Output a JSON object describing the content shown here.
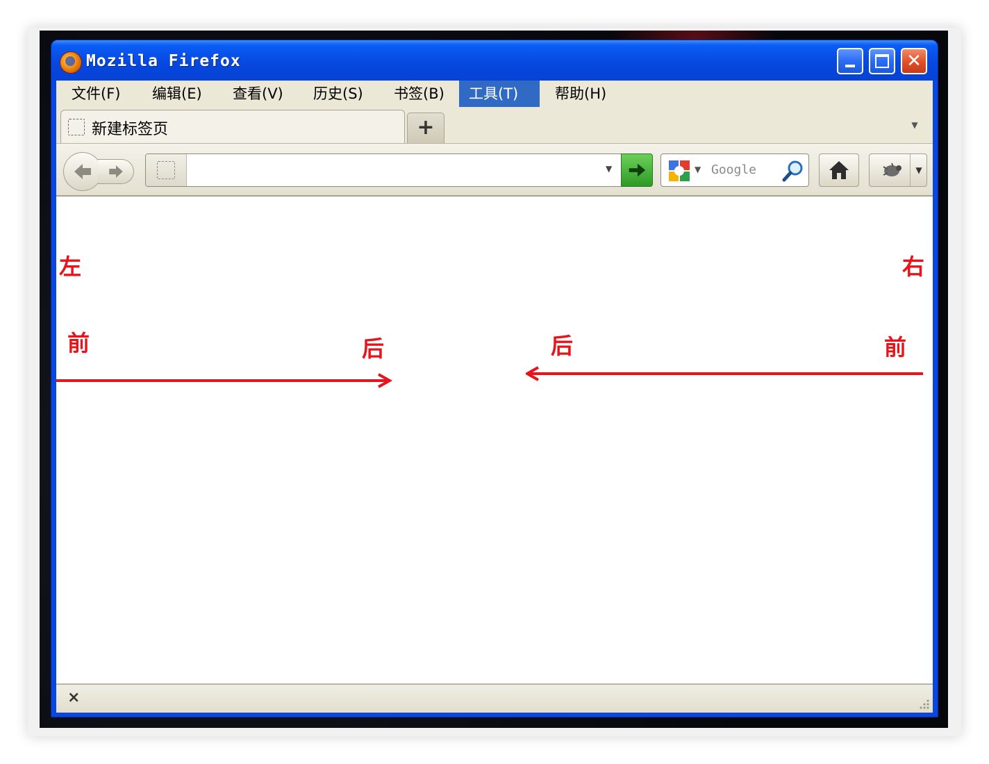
{
  "window": {
    "title": "Mozilla Firefox"
  },
  "menubar": {
    "items": [
      {
        "label": "文件(F)"
      },
      {
        "label": "编辑(E)"
      },
      {
        "label": "查看(V)"
      },
      {
        "label": "历史(S)"
      },
      {
        "label": "书签(B)"
      },
      {
        "label": "工具(T)",
        "active": true
      },
      {
        "label": "帮助(H)"
      }
    ]
  },
  "tabs": [
    {
      "label": "新建标签页",
      "selected": true
    }
  ],
  "toolbar": {
    "new_tab_glyph": "+",
    "url_value": "",
    "search_placeholder": "Google",
    "search_engine_icon": "google-icon"
  },
  "content": {
    "annotations": {
      "left": "左",
      "right": "右",
      "left_front": "前",
      "left_back": "后",
      "right_back": "后",
      "right_front": "前"
    },
    "arrow_color": "#e8141c"
  },
  "statusbar": {
    "close_glyph": "×"
  },
  "colors": {
    "titlebar": "#0748e0",
    "menu_active": "#316ac5",
    "chrome": "#ebe8d8"
  }
}
